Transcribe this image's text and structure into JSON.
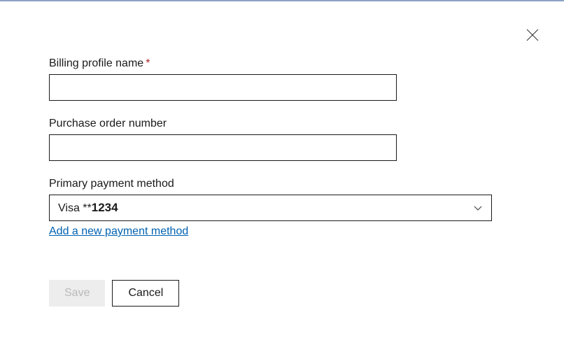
{
  "fields": {
    "billingProfile": {
      "label": "Billing profile name",
      "required": "*",
      "value": ""
    },
    "purchaseOrder": {
      "label": "Purchase order number",
      "value": ""
    },
    "paymentMethod": {
      "label": "Primary payment method",
      "selected_prefix": "Visa **",
      "selected_digits": "1234"
    }
  },
  "links": {
    "addPayment": "Add a new payment method"
  },
  "buttons": {
    "save": "Save",
    "cancel": "Cancel"
  }
}
